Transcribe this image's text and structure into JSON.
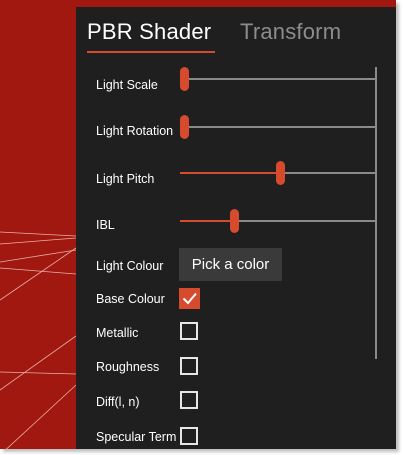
{
  "tabs": [
    {
      "label": "PBR Shader",
      "active": true
    },
    {
      "label": "Transform",
      "active": false
    }
  ],
  "sliders": [
    {
      "label": "Light Scale",
      "value": 0.0
    },
    {
      "label": "Light Rotation",
      "value": 0.0
    },
    {
      "label": "Light Pitch",
      "value": 0.5
    },
    {
      "label": "IBL",
      "value": 0.26
    }
  ],
  "light_colour": {
    "label": "Light Colour",
    "button_label": "Pick a color"
  },
  "checkboxes": [
    {
      "label": "Base Colour",
      "checked": true
    },
    {
      "label": "Metallic",
      "checked": false
    },
    {
      "label": "Roughness",
      "checked": false
    },
    {
      "label": "Diff(l, n)",
      "checked": false
    },
    {
      "label": "Specular Term",
      "checked": false
    }
  ],
  "colors": {
    "accent": "#d64a2e",
    "panel_bg": "#1f1f1f",
    "viewport_bg": "#a0180f",
    "track": "#8a8a8a"
  }
}
